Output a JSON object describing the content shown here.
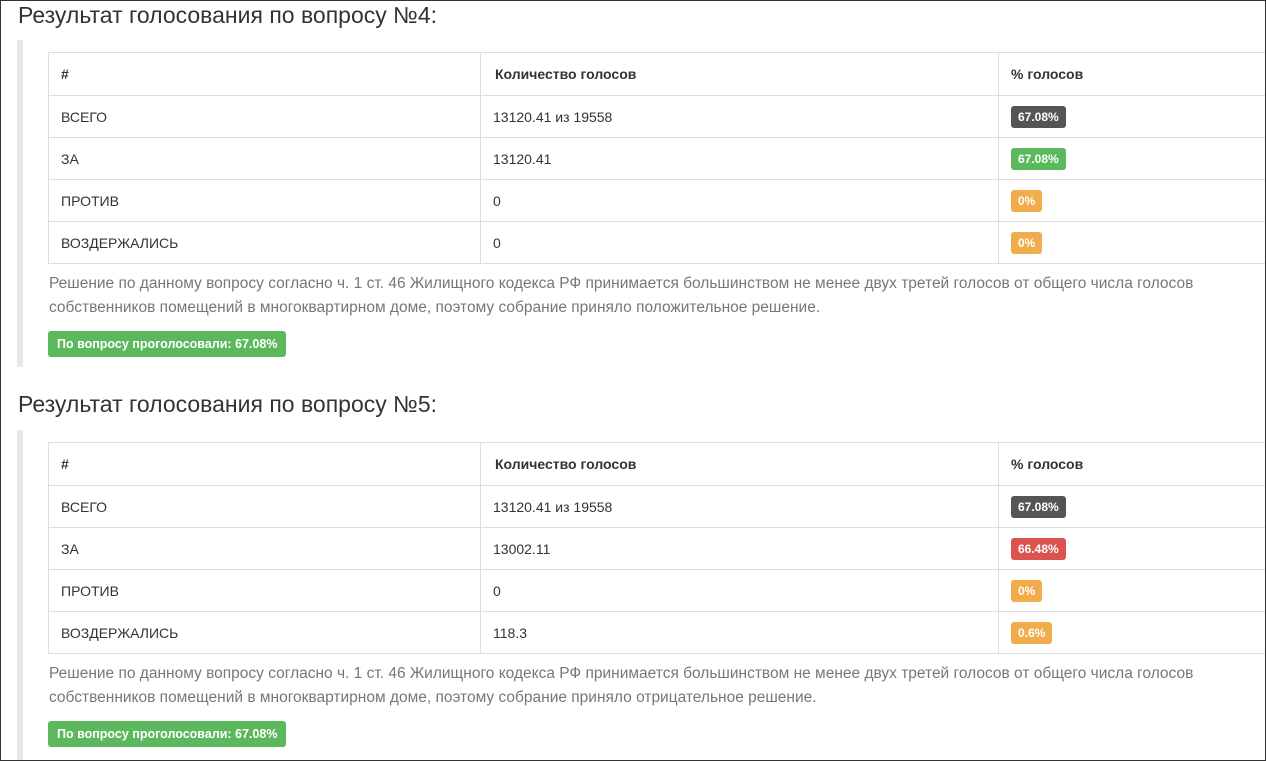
{
  "colors": {
    "total": "#555555",
    "for_pass": "#5cb85c",
    "for_fail": "#d9534f",
    "neutral": "#f0ad4e",
    "summary": "#5cb85c"
  },
  "sections": [
    {
      "title": "Результат голосования по вопросу №4:",
      "headers": [
        "#",
        "Количество голосов",
        "% голосов"
      ],
      "rows": [
        {
          "label": "ВСЕГО",
          "votes": "13120.41 из 19558",
          "percent": "67.08%",
          "badge": "total"
        },
        {
          "label": "ЗА",
          "votes": "13120.41",
          "percent": "67.08%",
          "badge": "for_pass"
        },
        {
          "label": "ПРОТИВ",
          "votes": "0",
          "percent": "0%",
          "badge": "neutral"
        },
        {
          "label": "ВОЗДЕРЖАЛИСЬ",
          "votes": "0",
          "percent": "0%",
          "badge": "neutral"
        }
      ],
      "note": "Решение по данному вопросу согласно ч. 1 ст. 46 Жилищного кодекса РФ принимается большинством не менее двух третей голосов от общего числа голосов собственников помещений в многоквартирном доме, поэтому собрание приняло положительное решение.",
      "summary": "По вопросу проголосовали: 67.08%"
    },
    {
      "title": "Результат голосования по вопросу №5:",
      "headers": [
        "#",
        "Количество голосов",
        "% голосов"
      ],
      "rows": [
        {
          "label": "ВСЕГО",
          "votes": "13120.41 из 19558",
          "percent": "67.08%",
          "badge": "total"
        },
        {
          "label": "ЗА",
          "votes": "13002.11",
          "percent": "66.48%",
          "badge": "for_fail"
        },
        {
          "label": "ПРОТИВ",
          "votes": "0",
          "percent": "0%",
          "badge": "neutral"
        },
        {
          "label": "ВОЗДЕРЖАЛИСЬ",
          "votes": "118.3",
          "percent": "0.6%",
          "badge": "neutral"
        }
      ],
      "note": "Решение по данному вопросу согласно ч. 1 ст. 46 Жилищного кодекса РФ принимается большинством не менее двух третей голосов от общего числа голосов собственников помещений в многоквартирном доме, поэтому собрание приняло отрицательное решение.",
      "summary": "По вопросу проголосовали: 67.08%"
    }
  ]
}
